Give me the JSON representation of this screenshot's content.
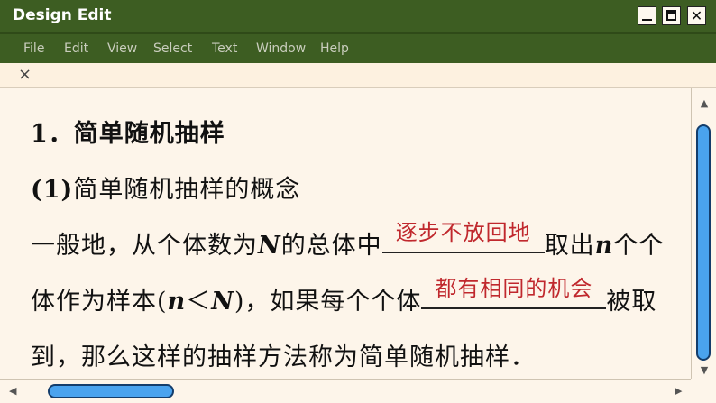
{
  "window": {
    "title": "Design Edit",
    "min_label": "",
    "close_label": "✕"
  },
  "menu": [
    "File",
    "Edit",
    "View",
    "Select",
    "Text",
    "Window",
    "Help"
  ],
  "toolbar": {
    "close_label": "×"
  },
  "doc": {
    "heading": "1．简单随机抽样",
    "subheading_num": "(1)",
    "subheading_text": "简单随机抽样的概念",
    "l3_a": "一般地，从个体数为",
    "l3_N": "N",
    "l3_b": "的总体中",
    "blank1": "逐步不放回地",
    "l3_c": "取出",
    "l3_n": "n",
    "l3_d": "个个",
    "l4_a": "体作为样本(",
    "l4_n": "n",
    "l4_lt": "＜",
    "l4_N": "N",
    "l4_b": ")，如果每个个体",
    "blank2": "都有相同的机会",
    "l4_c": "被取",
    "l5": "到，那么这样的抽样方法称为简单随机抽样．"
  },
  "scroll": {
    "up_icon": "▲",
    "down_icon": "▼",
    "left_icon": "◀",
    "right_icon": "▶"
  },
  "colors": {
    "titlebar": "#3d5d22",
    "background": "#fdf5ea",
    "answer": "#c0282d",
    "scroll_thumb": "#4aa3ee"
  }
}
